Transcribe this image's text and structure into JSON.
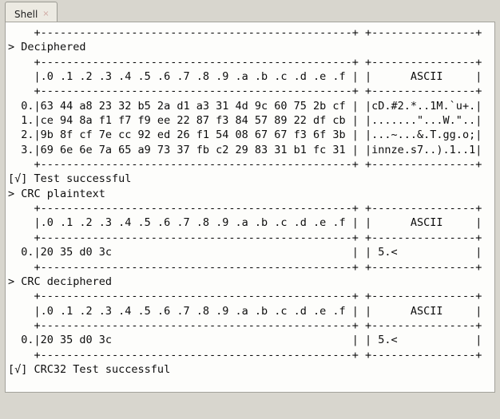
{
  "window": {
    "background_color": "#d8d6ce",
    "terminal_background": "#fdfdfb",
    "terminal_border_color": "#a3a29b",
    "text_color": "#0d0d0d"
  },
  "tab": {
    "label": "Shell",
    "close_glyph": "×"
  },
  "console": {
    "table_rule": "    +------------------------------------------------+ +----------------+",
    "header_row": "    |.0 .1 .2 .3 .4 .5 .6 .7 .8 .9 .a .b .c .d .e .f | |      ASCII     |",
    "sections": [
      {
        "prompt": "> Deciphered",
        "rows": [
          "  0.|63 44 a8 23 32 b5 2a d1 a3 31 4d 9c 60 75 2b cf | |cD.#2.*..1M.`u+.|",
          "  1.|ce 94 8a f1 f7 f9 ee 22 87 f3 84 57 89 22 df cb | |.......\"...W.\"..|",
          "  2.|9b 8f cf 7e cc 92 ed 26 f1 54 08 67 67 f3 6f 3b | |...~...&.T.gg.o;|",
          "  3.|69 6e 6e 7a 65 a9 73 37 fb c2 29 83 31 b1 fc 31 | |innze.s7..).1..1|"
        ],
        "status": "[√] Test successful"
      },
      {
        "prompt": "> CRC plaintext",
        "rows": [
          "  0.|20 35 d0 3c                                     | | 5.<            |"
        ],
        "status": null
      },
      {
        "prompt": "> CRC deciphered",
        "rows": [
          "  0.|20 35 d0 3c                                     | | 5.<            |"
        ],
        "status": "[√] CRC32 Test successful"
      }
    ],
    "lines": [
      "    +------------------------------------------------+ +----------------+",
      "> Deciphered",
      "    +------------------------------------------------+ +----------------+",
      "    |.0 .1 .2 .3 .4 .5 .6 .7 .8 .9 .a .b .c .d .e .f | |      ASCII     |",
      "    +------------------------------------------------+ +----------------+",
      "  0.|63 44 a8 23 32 b5 2a d1 a3 31 4d 9c 60 75 2b cf | |cD.#2.*..1M.`u+.|",
      "  1.|ce 94 8a f1 f7 f9 ee 22 87 f3 84 57 89 22 df cb | |.......\"...W.\"..|",
      "  2.|9b 8f cf 7e cc 92 ed 26 f1 54 08 67 67 f3 6f 3b | |...~...&.T.gg.o;|",
      "  3.|69 6e 6e 7a 65 a9 73 37 fb c2 29 83 31 b1 fc 31 | |innze.s7..).1..1|",
      "    +------------------------------------------------+ +----------------+",
      "[√] Test successful",
      "> CRC plaintext",
      "    +------------------------------------------------+ +----------------+",
      "    |.0 .1 .2 .3 .4 .5 .6 .7 .8 .9 .a .b .c .d .e .f | |      ASCII     |",
      "    +------------------------------------------------+ +----------------+",
      "  0.|20 35 d0 3c                                     | | 5.<            |",
      "    +------------------------------------------------+ +----------------+",
      "> CRC deciphered",
      "    +------------------------------------------------+ +----------------+",
      "    |.0 .1 .2 .3 .4 .5 .6 .7 .8 .9 .a .b .c .d .e .f | |      ASCII     |",
      "    +------------------------------------------------+ +----------------+",
      "  0.|20 35 d0 3c                                     | | 5.<            |",
      "    +------------------------------------------------+ +----------------+",
      "[√] CRC32 Test successful"
    ]
  }
}
